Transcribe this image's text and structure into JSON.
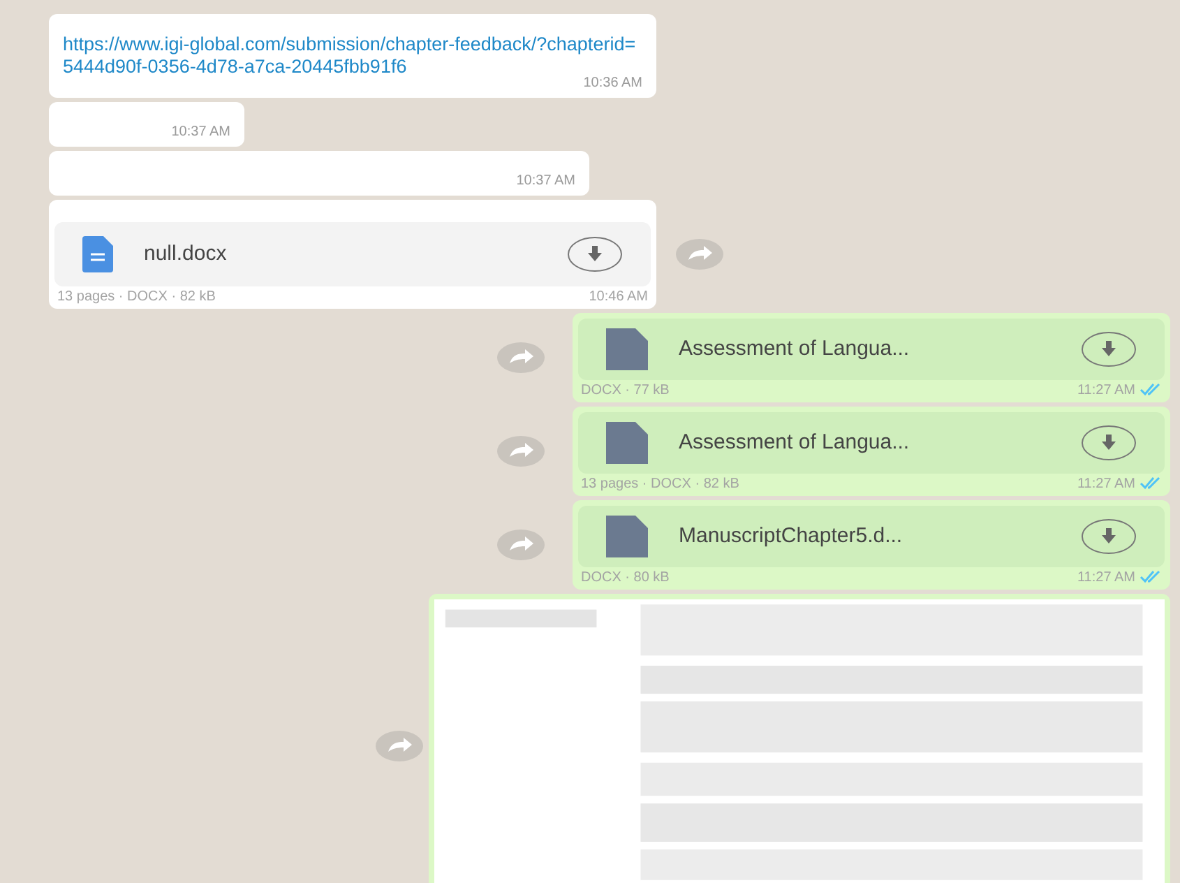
{
  "messages": [
    {
      "kind": "link",
      "text": "https://www.igi-global.com/submission/chapter-feedback/?chapterid=5444d90f-0356-4d78-a7ca-20445fbb91f6",
      "time": "10:36 AM",
      "forward": false
    },
    {
      "kind": "text",
      "time": "10:37 AM",
      "forward": false
    },
    {
      "kind": "text",
      "time": "10:37 AM",
      "forward": false
    },
    {
      "kind": "received_doc",
      "name": "null.docx",
      "meta": "13 pages · DOCX · 82 kB",
      "time": "10:46 AM",
      "forward": true
    },
    {
      "kind": "sent_file",
      "name": "Assessment of Langua...",
      "meta": "DOCX · 77 kB",
      "time": "11:27 AM",
      "read": true,
      "forward": true
    },
    {
      "kind": "sent_file",
      "name": "Assessment of Langua...",
      "meta": "13 pages · DOCX · 82 kB",
      "time": "11:27 AM",
      "read": true,
      "forward": true
    },
    {
      "kind": "sent_file",
      "name": "ManuscriptChapter5.d...",
      "meta": "DOCX · 80 kB",
      "time": "11:27 AM",
      "read": true,
      "forward": true
    },
    {
      "kind": "sent_image",
      "forward": true
    }
  ]
}
